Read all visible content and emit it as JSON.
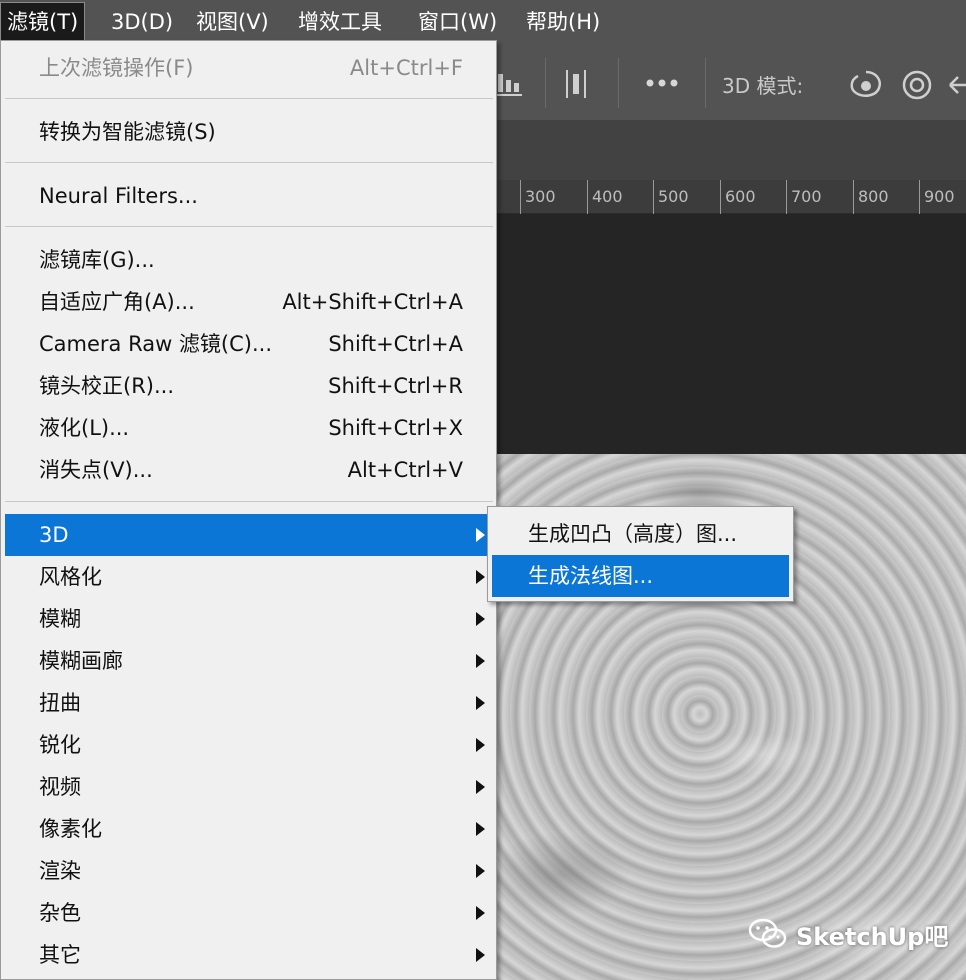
{
  "menubar": {
    "filter": "滤镜(T)",
    "3d": "3D(D)",
    "view": "视图(V)",
    "plugins": "增效工具",
    "window": "窗口(W)",
    "help": "帮助(H)"
  },
  "options_bar": {
    "mode_label": "3D 模式:",
    "icons": [
      "align-bottom-icon",
      "distribute-icon",
      "more-icon",
      "orbit-3d-icon",
      "rotate-3d-icon",
      "drag-3d-icon"
    ]
  },
  "ruler": {
    "ticks": [
      "300",
      "400",
      "500",
      "600",
      "700",
      "800",
      "900"
    ]
  },
  "filter_menu": {
    "last_filter": {
      "label": "上次滤镜操作(F)",
      "shortcut": "Alt+Ctrl+F"
    },
    "smart_filters": {
      "label": "转换为智能滤镜(S)"
    },
    "neural_filters": {
      "label": "Neural Filters..."
    },
    "filter_gallery": {
      "label": "滤镜库(G)..."
    },
    "adaptive_wide_angle": {
      "label": "自适应广角(A)...",
      "shortcut": "Alt+Shift+Ctrl+A"
    },
    "camera_raw": {
      "label": "Camera Raw 滤镜(C)...",
      "shortcut": "Shift+Ctrl+A"
    },
    "lens_correction": {
      "label": "镜头校正(R)...",
      "shortcut": "Shift+Ctrl+R"
    },
    "liquify": {
      "label": "液化(L)...",
      "shortcut": "Shift+Ctrl+X"
    },
    "vanishing_point": {
      "label": "消失点(V)...",
      "shortcut": "Alt+Ctrl+V"
    },
    "submenus": [
      "3D",
      "风格化",
      "模糊",
      "模糊画廊",
      "扭曲",
      "锐化",
      "视频",
      "像素化",
      "渲染",
      "杂色",
      "其它"
    ]
  },
  "submenu_3d": {
    "bump_map": "生成凹凸（高度）图...",
    "normal_map": "生成法线图..."
  },
  "watermark": {
    "text": "SketchUp吧"
  },
  "colors": {
    "highlight": "#0b76d6",
    "menu_bg": "#f0f0f0",
    "app_bg": "#535353"
  }
}
